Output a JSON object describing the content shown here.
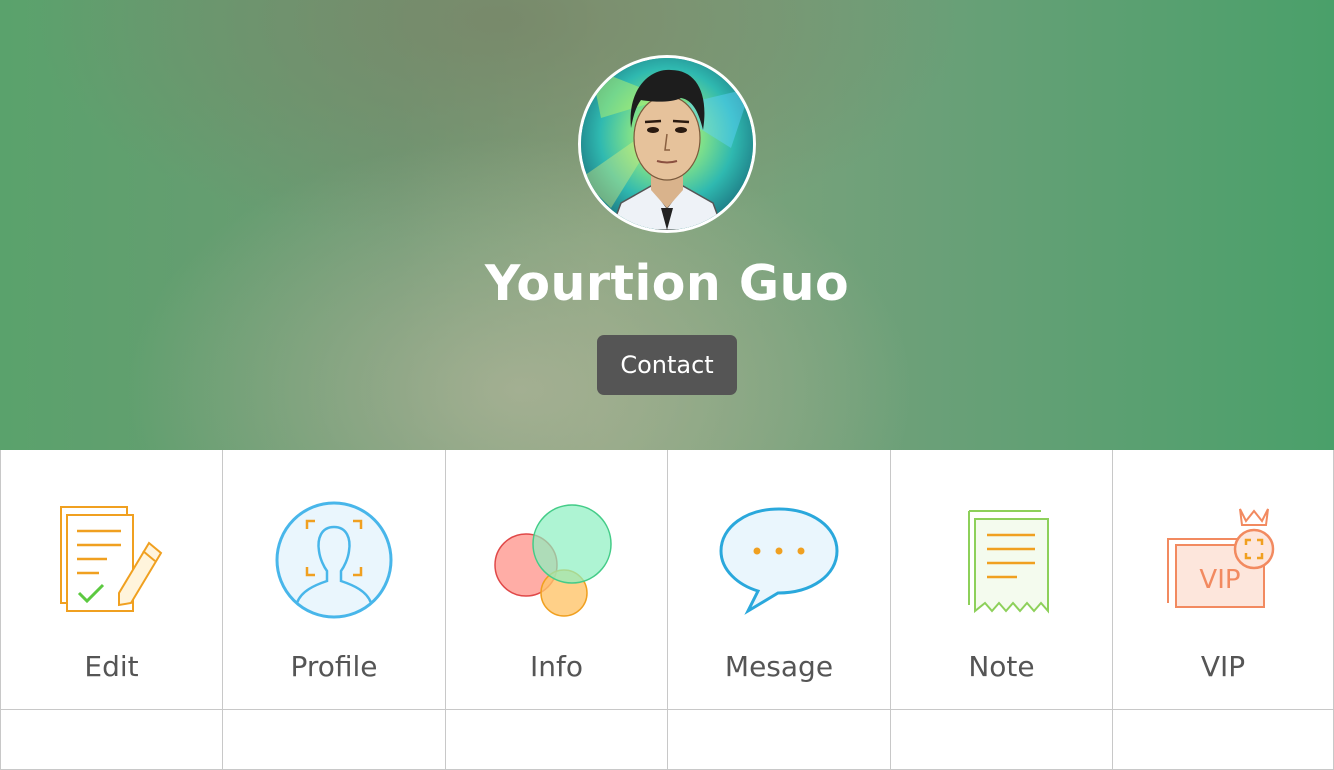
{
  "profile": {
    "name": "Yourtion Guo",
    "contact_label": "Contact"
  },
  "menu": {
    "items": [
      {
        "label": "Edit",
        "icon": "edit-document-icon"
      },
      {
        "label": "Profile",
        "icon": "profile-face-icon"
      },
      {
        "label": "Info",
        "icon": "info-circles-icon"
      },
      {
        "label": "Mesage",
        "icon": "message-bubble-icon"
      },
      {
        "label": "Note",
        "icon": "note-receipt-icon"
      },
      {
        "label": "VIP",
        "icon": "vip-card-icon"
      }
    ]
  },
  "colors": {
    "contact_button": "#555555",
    "label_text": "#555555",
    "grid_line": "#c8c8c8"
  }
}
